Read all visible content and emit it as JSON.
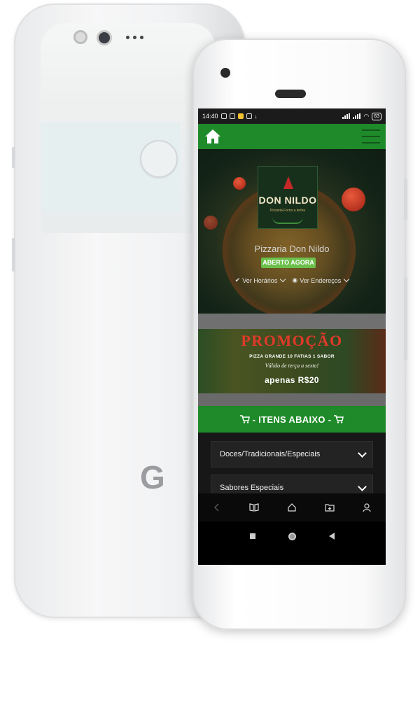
{
  "status_bar": {
    "time": "14:40",
    "battery": "63"
  },
  "brand": {
    "logo_title": "DON NILDO",
    "logo_subtitle": "Pizzaria Forno a lenha",
    "name": "Pizzaria Don Nildo",
    "status_badge": "ABERTO AGORA",
    "hours_link": "Ver Horários",
    "address_link": "Ver Endereços"
  },
  "promo": {
    "title": "PROMOÇÃO",
    "line1": "PIZZA GRANDE 10 FATIAS 1 SABOR",
    "line2": "Válido de terça a sexta!",
    "line3": "apenas R$20"
  },
  "items_section": {
    "title": "- ITENS ABAIXO -",
    "categories": [
      {
        "label": "Doces/Tradicionais/Especiais"
      },
      {
        "label": "Sabores Especiais"
      }
    ]
  },
  "device": {
    "back_logo": "G"
  },
  "colors": {
    "accent_green": "#1f8a2a",
    "badge_green": "#6bc04b",
    "promo_red": "#e03a2a"
  }
}
